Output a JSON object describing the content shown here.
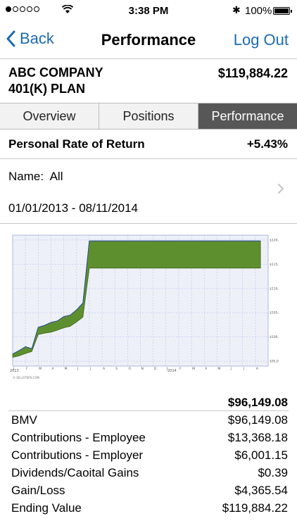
{
  "status_bar": {
    "time": "3:38 PM",
    "battery": "100%"
  },
  "nav": {
    "back_label": "Back",
    "title": "Performance",
    "logout_label": "Log Out"
  },
  "plan": {
    "name_line1": "ABC COMPANY",
    "name_line2": "401(K) PLAN",
    "balance": "$119,884.22"
  },
  "tabs": [
    {
      "label": "Overview",
      "active": false
    },
    {
      "label": "Positions",
      "active": false
    },
    {
      "label": "Performance",
      "active": true
    }
  ],
  "rate_of_return": {
    "label": "Personal Rate of Return",
    "value": "+5.43%"
  },
  "filter": {
    "name_label": "Name:",
    "name_value": "All",
    "date_range": "01/01/2013 - 08/11/2014"
  },
  "chart_data": {
    "type": "area",
    "y_tick_labels": [
      "$120,000",
      "$115,000",
      "$110,000",
      "$105,000",
      "$100,000",
      "$95,000"
    ],
    "y_ticks": [
      120000,
      115000,
      110000,
      105000,
      100000,
      95000
    ],
    "ylim": [
      94000,
      121000
    ],
    "x_tick_labels": [
      "J",
      "F",
      "M",
      "A",
      "M",
      "J",
      "J",
      "A",
      "S",
      "O",
      "N",
      "D",
      "J",
      "F",
      "M",
      "A",
      "M",
      "J",
      "J",
      "A"
    ],
    "x_year_labels": [
      "2013",
      "2014"
    ],
    "copyright": "© SELLSTEPS.COM",
    "months": [
      0,
      0.5,
      1,
      1.5,
      2,
      2.5,
      3,
      3.5,
      4,
      4.5,
      5,
      5.5,
      6,
      6.5,
      7,
      8,
      9,
      10,
      11,
      12,
      13,
      14,
      15,
      16,
      17,
      18,
      19,
      19.4
    ],
    "upper": [
      96500,
      97200,
      98000,
      97600,
      102000,
      102400,
      103000,
      103300,
      104200,
      104500,
      105600,
      107000,
      119800,
      119800,
      119800,
      119800,
      119800,
      119800,
      119800,
      119800,
      119800,
      119800,
      119800,
      119800,
      119800,
      119800,
      119800,
      119800
    ],
    "lower": [
      95800,
      96100,
      96600,
      97000,
      100500,
      100800,
      101000,
      101400,
      101900,
      102200,
      103100,
      104100,
      114200,
      114200,
      114200,
      114200,
      114200,
      114200,
      114200,
      114200,
      114200,
      114200,
      114200,
      114200,
      114200,
      114200,
      114200,
      114200
    ]
  },
  "summary": {
    "total": "$96,149.08",
    "rows": [
      {
        "label": "BMV",
        "value": "$96,149.08"
      },
      {
        "label": "Contributions - Employee",
        "value": "$13,368.18"
      },
      {
        "label": "Contributions - Employer",
        "value": "$6,001.15"
      },
      {
        "label": "Dividends/Caoital Gains",
        "value": "$0.39"
      },
      {
        "label": "Gain/Loss",
        "value": "$4,365.54"
      },
      {
        "label": "Ending Value",
        "value": "$119,884.22"
      }
    ]
  }
}
